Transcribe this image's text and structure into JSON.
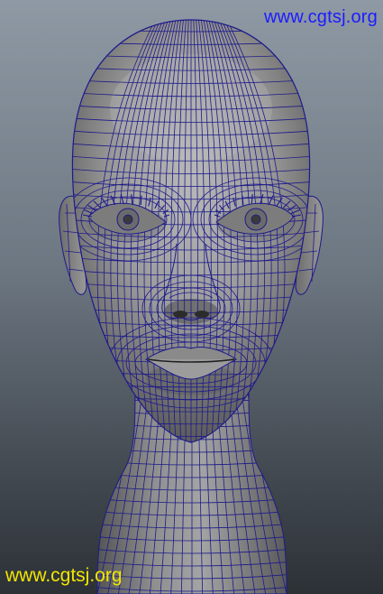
{
  "watermarks": {
    "top": "www.cgtsj.org",
    "bottom": "www.cgtsj.org"
  },
  "colors": {
    "watermark_top": "#1c1cff",
    "watermark_bottom": "#f2e600",
    "wire": "#1d1a8a",
    "skin_light": "#b1b1b1",
    "skin_mid": "#8c8c8c",
    "skin_dark": "#5a5a5a"
  }
}
